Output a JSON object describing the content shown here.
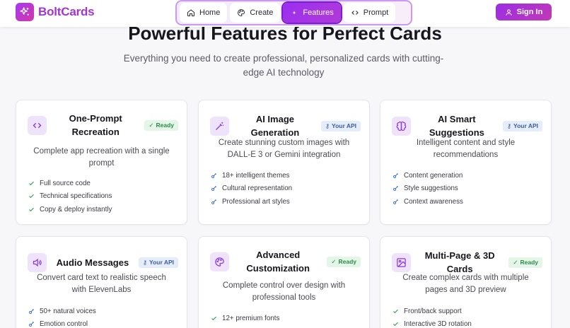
{
  "brand": {
    "name": "BoltCards"
  },
  "nav": {
    "items": [
      {
        "label": "Home",
        "icon": "home-icon"
      },
      {
        "label": "Create",
        "icon": "palette-icon"
      },
      {
        "label": "Features",
        "icon": "sparkle-icon",
        "active": true
      },
      {
        "label": "Prompt",
        "icon": "code-icon"
      }
    ]
  },
  "header": {
    "sign_in_label": "Sign In"
  },
  "hero": {
    "title": "Powerful Features for Perfect Cards",
    "subtitle": "Everything you need to create professional, personalized cards with cutting-edge AI technology"
  },
  "cards": [
    {
      "title": "One-Prompt Recreation",
      "badge": "Ready",
      "badge_type": "ready",
      "icon": "code-icon",
      "description": "Complete app recreation with a single prompt",
      "features": [
        "Full source code",
        "Technical specifications",
        "Copy & deploy instantly"
      ]
    },
    {
      "title": "AI Image Generation",
      "badge": "Your API",
      "badge_type": "api",
      "icon": "magic-wand-icon",
      "description": "Create stunning custom images with DALL-E 3 or Gemini integration",
      "features": [
        "18+ intelligent themes",
        "Cultural representation",
        "Professional art styles"
      ]
    },
    {
      "title": "AI Smart Suggestions",
      "badge": "Your API",
      "badge_type": "api",
      "icon": "brain-icon",
      "description": "Intelligent content and style recommendations",
      "features": [
        "Content generation",
        "Style suggestions",
        "Context awareness"
      ]
    },
    {
      "title": "Audio Messages",
      "badge": "Your API",
      "badge_type": "api",
      "icon": "speaker-icon",
      "description": "Convert card text to realistic speech with ElevenLabs",
      "features": [
        "50+ natural voices",
        "Emotion control"
      ]
    },
    {
      "title": "Advanced Customization",
      "badge": "Ready",
      "badge_type": "ready",
      "icon": "palette-icon",
      "description": "Complete control over design with professional tools",
      "features": [
        "12+ premium fonts"
      ]
    },
    {
      "title": "Multi-Page & 3D Cards",
      "badge": "Ready",
      "badge_type": "ready",
      "icon": "image-icon",
      "description": "Create complex cards with multiple pages and 3D preview",
      "features": [
        "Front/back support",
        "Interactive 3D rotation"
      ]
    }
  ],
  "colors": {
    "accent": "#9b2ff0",
    "ready_badge_bg": "#e3f6e8",
    "api_badge_bg": "#e5ecfa",
    "check_green": "#2f9a55",
    "key_blue": "#3d6fc9"
  }
}
